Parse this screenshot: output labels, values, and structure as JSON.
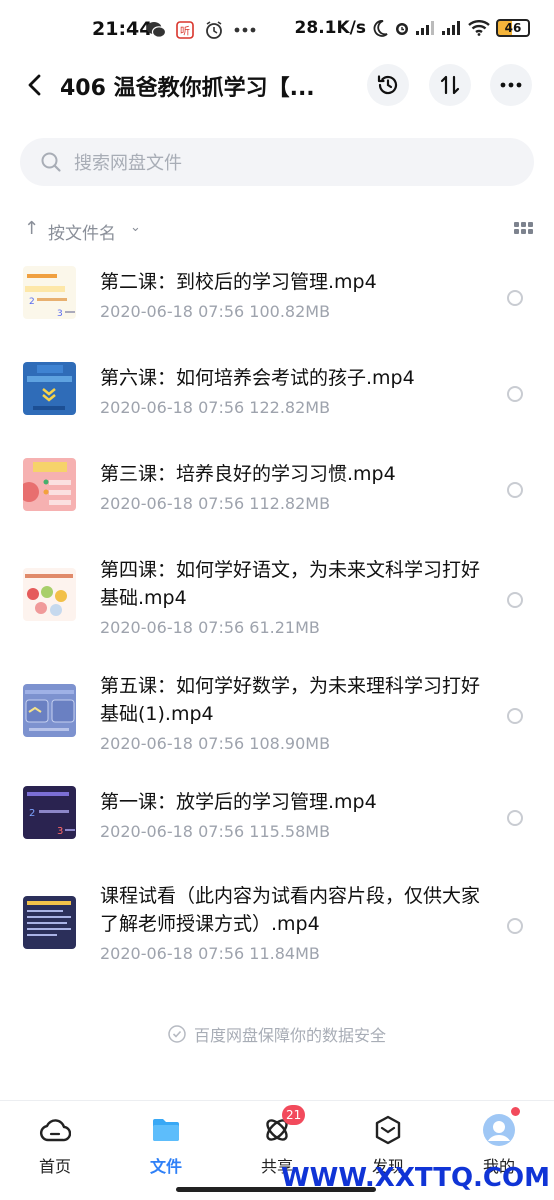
{
  "status_bar": {
    "time": "21:44",
    "net_speed": "28.1K/s",
    "battery": "46"
  },
  "header": {
    "title": "406 温爸教你抓学习【..."
  },
  "search": {
    "placeholder": "搜索网盘文件"
  },
  "sort": {
    "label": "按文件名"
  },
  "files": [
    {
      "name": "第二课：到校后的学习管理.mp4",
      "date": "2020-06-18",
      "time": "07:56",
      "size": "100.82MB"
    },
    {
      "name": "第六课：如何培养会考试的孩子.mp4",
      "date": "2020-06-18",
      "time": "07:56",
      "size": "122.82MB"
    },
    {
      "name": "第三课：培养良好的学习习惯.mp4",
      "date": "2020-06-18",
      "time": "07:56",
      "size": "112.82MB"
    },
    {
      "name": "第四课：如何学好语文，为未来文科学习打好基础.mp4",
      "date": "2020-06-18",
      "time": "07:56",
      "size": "61.21MB"
    },
    {
      "name": "第五课：如何学好数学，为未来理科学习打好基础(1).mp4",
      "date": "2020-06-18",
      "time": "07:56",
      "size": "108.90MB"
    },
    {
      "name": "第一课：放学后的学习管理.mp4",
      "date": "2020-06-18",
      "time": "07:56",
      "size": "115.58MB"
    },
    {
      "name": "课程试看（此内容为试看内容片段，仅供大家了解老师授课方式）.mp4",
      "date": "2020-06-18",
      "time": "07:56",
      "size": "11.84MB"
    }
  ],
  "safe_note": "百度网盘保障你的数据安全",
  "nav": {
    "home": "首页",
    "files": "文件",
    "share": "共享",
    "share_badge": "21",
    "discover": "发现",
    "mine": "我的"
  },
  "watermark": "WWW.XXTTQ.COM",
  "colors": {
    "accent": "#2f80f7",
    "badge": "#f24a5c"
  }
}
